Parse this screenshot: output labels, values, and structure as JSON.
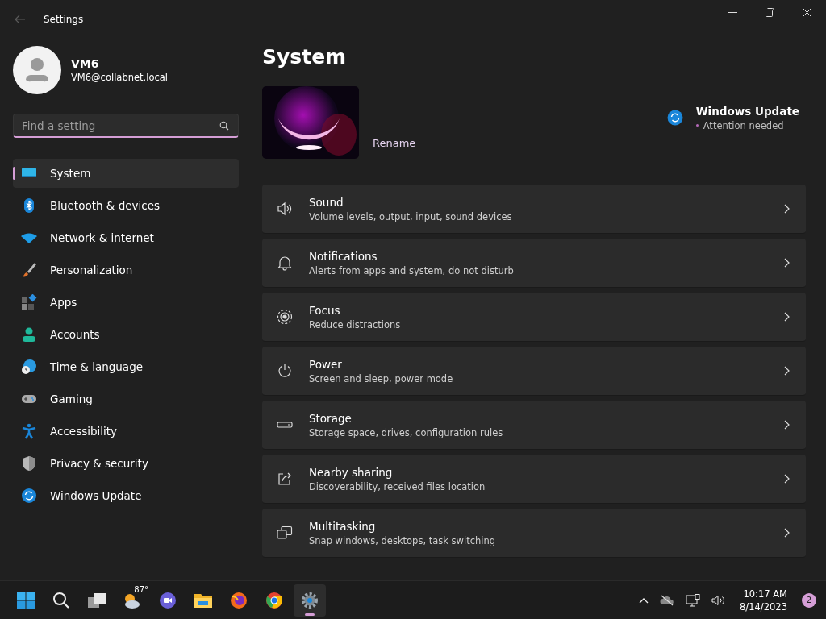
{
  "window": {
    "title": "Settings"
  },
  "account": {
    "name": "VM6",
    "email": "VM6@collabnet.local"
  },
  "search": {
    "placeholder": "Find a setting"
  },
  "sidebar": {
    "items": [
      {
        "label": "System",
        "selected": true
      },
      {
        "label": "Bluetooth & devices",
        "selected": false
      },
      {
        "label": "Network & internet",
        "selected": false
      },
      {
        "label": "Personalization",
        "selected": false
      },
      {
        "label": "Apps",
        "selected": false
      },
      {
        "label": "Accounts",
        "selected": false
      },
      {
        "label": "Time & language",
        "selected": false
      },
      {
        "label": "Gaming",
        "selected": false
      },
      {
        "label": "Accessibility",
        "selected": false
      },
      {
        "label": "Privacy & security",
        "selected": false
      },
      {
        "label": "Windows Update",
        "selected": false
      }
    ]
  },
  "page": {
    "title": "System",
    "rename": "Rename",
    "update": {
      "title": "Windows Update",
      "status": "Attention needed"
    }
  },
  "settings": [
    {
      "title": "Sound",
      "description": "Volume levels, output, input, sound devices"
    },
    {
      "title": "Notifications",
      "description": "Alerts from apps and system, do not disturb"
    },
    {
      "title": "Focus",
      "description": "Reduce distractions"
    },
    {
      "title": "Power",
      "description": "Screen and sleep, power mode"
    },
    {
      "title": "Storage",
      "description": "Storage space, drives, configuration rules"
    },
    {
      "title": "Nearby sharing",
      "description": "Discoverability, received files location"
    },
    {
      "title": "Multitasking",
      "description": "Snap windows, desktops, task switching"
    }
  ],
  "taskbar": {
    "weather": "87°",
    "apps": [
      {
        "active": false
      },
      {
        "active": false
      },
      {
        "active": false
      },
      {
        "active": false
      },
      {
        "active": false
      },
      {
        "active": false
      },
      {
        "active": true
      }
    ],
    "time": "10:17 AM",
    "date": "8/14/2023",
    "notifications": "2"
  }
}
